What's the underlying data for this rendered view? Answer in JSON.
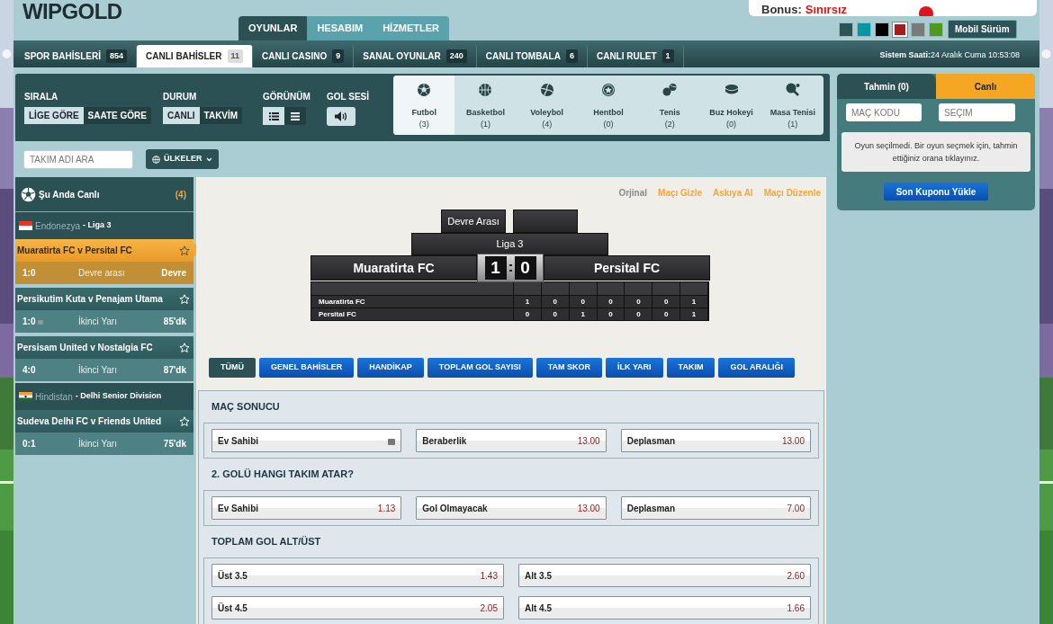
{
  "logo": "WIPGOLD",
  "bonus": {
    "label": "Bonus:",
    "value": "Sınırsız"
  },
  "main_nav": [
    {
      "label": "OYUNLAR",
      "selected": true
    },
    {
      "label": "HESABIM",
      "selected": false
    },
    {
      "label": "HİZMETLER",
      "selected": false
    }
  ],
  "theme_swatches": [
    {
      "color": "#2b5459",
      "selected": false
    },
    {
      "color": "#0596a5",
      "selected": false
    },
    {
      "color": "#000000",
      "selected": false
    },
    {
      "color": "#a71c1c",
      "selected": true
    },
    {
      "color": "#7a7a7a",
      "selected": false
    },
    {
      "color": "#4e9a1c",
      "selected": false
    }
  ],
  "mobile_button": "Mobil Sürüm",
  "category_tabs": [
    {
      "label": "SPOR BAHİSLERİ",
      "count": "854",
      "selected": false
    },
    {
      "label": "CANLI BAHİSLER",
      "count": "11",
      "selected": true
    },
    {
      "label": "CANLI CASINO",
      "count": "9",
      "selected": false
    },
    {
      "label": "SANAL OYUNLAR",
      "count": "240",
      "selected": false
    },
    {
      "label": "CANLI TOMBALA",
      "count": "6",
      "selected": false
    },
    {
      "label": "CANLI RULET",
      "count": "1",
      "selected": false
    }
  ],
  "system_time": {
    "label": "Sistem Saati:",
    "value": "24 Aralık Cuma 10:53:08"
  },
  "filters": {
    "sort": {
      "title": "SIRALA",
      "options": [
        {
          "label": "LİGE GÖRE",
          "selected": true
        },
        {
          "label": "SAATE GÖRE",
          "selected": false
        }
      ]
    },
    "status": {
      "title": "DURUM",
      "options": [
        {
          "label": "CANLI",
          "selected": true
        },
        {
          "label": "TAKVİM",
          "selected": false
        }
      ]
    },
    "view": {
      "title": "GÖRÜNÜM",
      "options": [
        {
          "kind": "detailed",
          "selected": true
        },
        {
          "kind": "compact",
          "selected": false
        }
      ]
    },
    "goal_sound": {
      "title": "GOL SESİ",
      "on": true
    }
  },
  "sports": [
    {
      "kind": "football",
      "label": "Futbol",
      "count": "(3)",
      "selected": true
    },
    {
      "kind": "basketball",
      "label": "Basketbol",
      "count": "(1)",
      "selected": false
    },
    {
      "kind": "volleyball",
      "label": "Voleybol",
      "count": "(4)",
      "selected": false
    },
    {
      "kind": "handball",
      "label": "Hentbol",
      "count": "(0)",
      "selected": false
    },
    {
      "kind": "tennis",
      "label": "Tenis",
      "count": "(2)",
      "selected": false
    },
    {
      "kind": "hockey",
      "label": "Buz Hokeyi",
      "count": "(0)",
      "selected": false
    },
    {
      "kind": "tabletennis",
      "label": "Masa Tenisi",
      "count": "(1)",
      "selected": false
    }
  ],
  "team_search": {
    "placeholder": "TAKIM ADI ARA"
  },
  "countries_button": "ÜLKELER",
  "live_list": {
    "title": "Şu Anda Canlı",
    "count": "(4)",
    "leagues": [
      {
        "kind": "indonesia",
        "country": "Endonezya",
        "league": "- Liga 3",
        "matches": [
          {
            "teams": "Muaratirta FC v Persital FC",
            "score": "1:0",
            "period": "Devre arası",
            "time": "Devre",
            "selected": true
          },
          {
            "teams": "Persikutim Kuta v Penajam Utama",
            "score": "1:0",
            "period": "İkinci Yarı",
            "time": "85'dk",
            "selected": false,
            "locked": true
          },
          {
            "teams": "Persisam United v Nostalgia FC",
            "score": "4:0",
            "period": "İkinci Yarı",
            "time": "87'dk",
            "selected": false
          }
        ]
      },
      {
        "kind": "india",
        "country": "Hindistan",
        "league": "- Delhi Senior Division",
        "matches": [
          {
            "teams": "Sudeva Delhi FC v Friends United",
            "score": "0:1",
            "period": "İkinci Yarı",
            "time": "75'dk",
            "selected": false
          }
        ]
      }
    ]
  },
  "match_links": [
    {
      "label": "Orjinal",
      "selected": true
    },
    {
      "label": "Maçı Gizle",
      "selected": false
    },
    {
      "label": "Askıya Al",
      "selected": false
    },
    {
      "label": "Maçı Düzenle",
      "selected": false
    }
  ],
  "scoreboard": {
    "status": "Devre Arası",
    "league": "Liga 3",
    "home": "Muaratirta FC",
    "away": "Persital FC",
    "home_score": "1",
    "away_score": "0",
    "rows": [
      {
        "team": "Muaratirta FC",
        "cells": [
          "1",
          "0",
          "0",
          "0",
          "0",
          "0",
          "1"
        ]
      },
      {
        "team": "Persital FC",
        "cells": [
          "0",
          "0",
          "1",
          "0",
          "0",
          "0",
          "1"
        ]
      }
    ]
  },
  "market_tabs": [
    {
      "label": "TÜMÜ",
      "selected": true
    },
    {
      "label": "GENEL BAHİSLER",
      "selected": false
    },
    {
      "label": "HANDİKAP",
      "selected": false
    },
    {
      "label": "TOPLAM GOL SAYISI",
      "selected": false
    },
    {
      "label": "TAM SKOR",
      "selected": false
    },
    {
      "label": "İLK YARI",
      "selected": false
    },
    {
      "label": "TAKIM",
      "selected": false
    },
    {
      "label": "GOL ARALIĞI",
      "selected": false
    }
  ],
  "markets": [
    {
      "title": "MAÇ SONUCU",
      "rows": [
        [
          {
            "label": "Ev Sahibi",
            "locked": true
          },
          {
            "label": "Beraberlik",
            "odd": "13.00"
          },
          {
            "label": "Deplasman",
            "odd": "13.00"
          }
        ]
      ]
    },
    {
      "title": "2. GOLÜ HANGI TAKIM ATAR?",
      "rows": [
        [
          {
            "label": "Ev Sahibi",
            "odd": "1.13"
          },
          {
            "label": "Gol Olmayacak",
            "odd": "13.00"
          },
          {
            "label": "Deplasman",
            "odd": "7.00"
          }
        ]
      ]
    },
    {
      "title": "TOPLAM GOL ALT/ÜST",
      "rows": [
        [
          {
            "label": "Üst 3.5",
            "odd": "1.43"
          },
          {
            "label": "Alt 3.5",
            "odd": "2.60"
          }
        ],
        [
          {
            "label": "Üst 4.5",
            "odd": "2.05"
          },
          {
            "label": "Alt 4.5",
            "odd": "1.66"
          }
        ]
      ]
    }
  ],
  "betslip": {
    "tabs": [
      {
        "label": "Tahmin (0)",
        "selected": true
      },
      {
        "label": "Canlı",
        "selected": false
      }
    ],
    "code_field": {
      "placeholder": "MAÇ KODU"
    },
    "choice_field": {
      "placeholder": "SEÇİM"
    },
    "message": "Oyun seçilmedi. Bir oyun seçmek için, tahmin ettiğiniz orana tıklayınız.",
    "button": "Son Kuponu Yükle"
  }
}
